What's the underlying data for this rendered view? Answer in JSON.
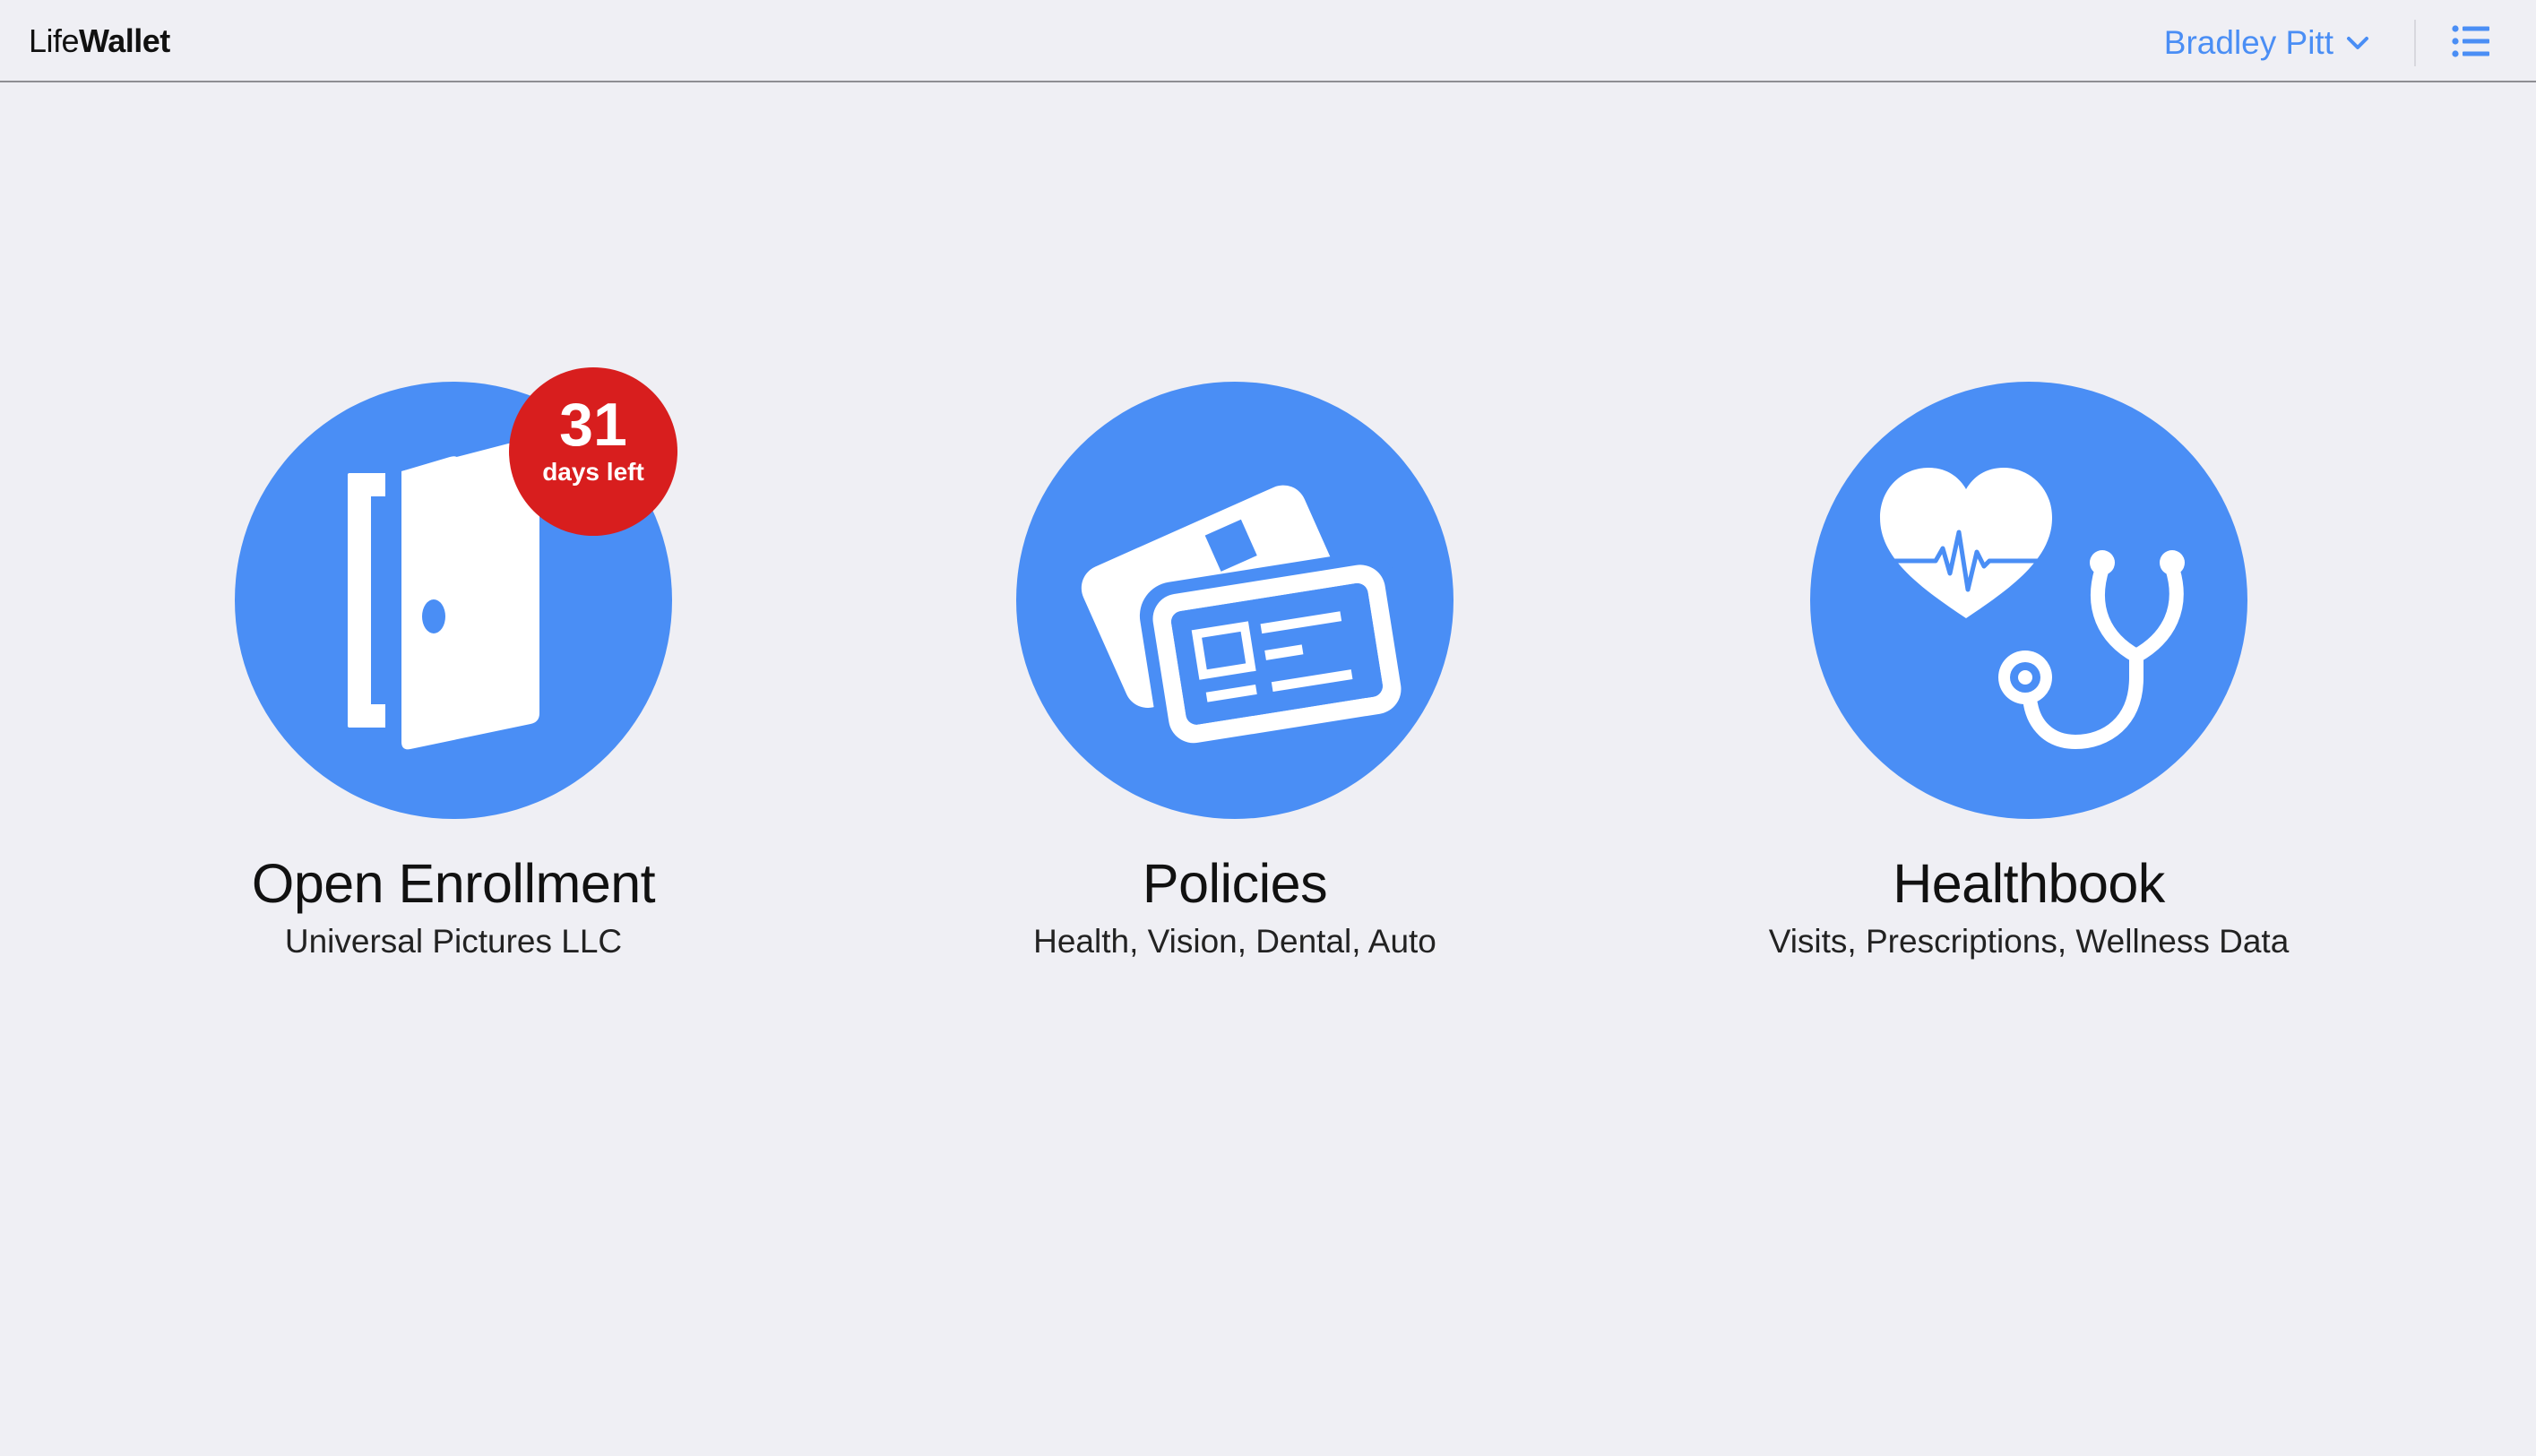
{
  "app": {
    "brand_light": "Life",
    "brand_bold": "Wallet"
  },
  "header": {
    "user_name": "Bradley Pitt",
    "user_menu_icon": "chevron-down-icon",
    "menu_icon": "list-icon"
  },
  "colors": {
    "accent": "#4a8ef5",
    "badge": "#d81e1e",
    "background": "#efeff4"
  },
  "tiles": [
    {
      "title": "Open Enrollment",
      "subtitle": "Universal Pictures LLC",
      "icon": "door-icon",
      "badge": {
        "number": "31",
        "label": "days left"
      }
    },
    {
      "title": "Policies",
      "subtitle": "Health, Vision, Dental, Auto",
      "icon": "id-cards-icon"
    },
    {
      "title": "Healthbook",
      "subtitle": "Visits, Prescriptions, Wellness Data",
      "icon": "heart-stethoscope-icon"
    }
  ]
}
